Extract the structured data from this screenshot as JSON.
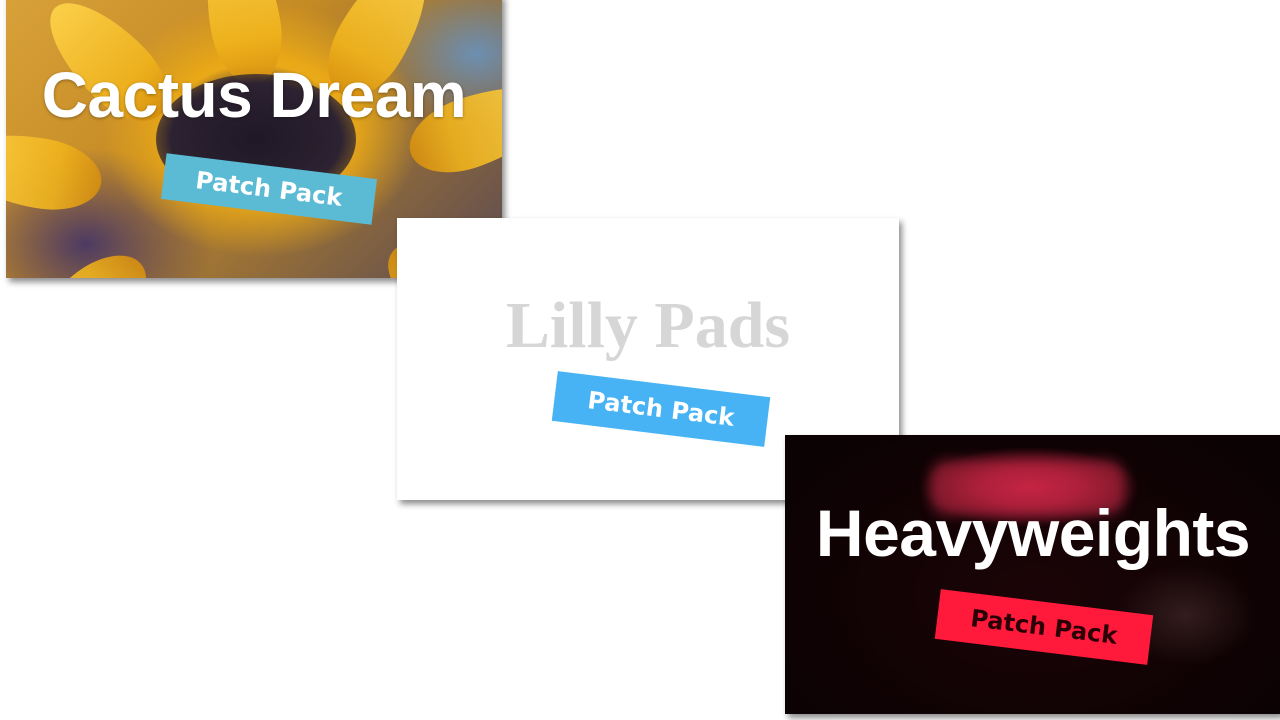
{
  "cards": [
    {
      "title": "Cactus Dream",
      "badge": "Patch Pack",
      "badge_color": "#5bbad4",
      "title_color": "#ffffff"
    },
    {
      "title": "Lilly Pads",
      "badge": "Patch Pack",
      "badge_color": "#47b3f5",
      "title_color": "#d6d6d6"
    },
    {
      "title": "Heavyweights",
      "badge": "Patch Pack",
      "badge_color": "#ff1a3c",
      "title_color": "#ffffff"
    }
  ]
}
